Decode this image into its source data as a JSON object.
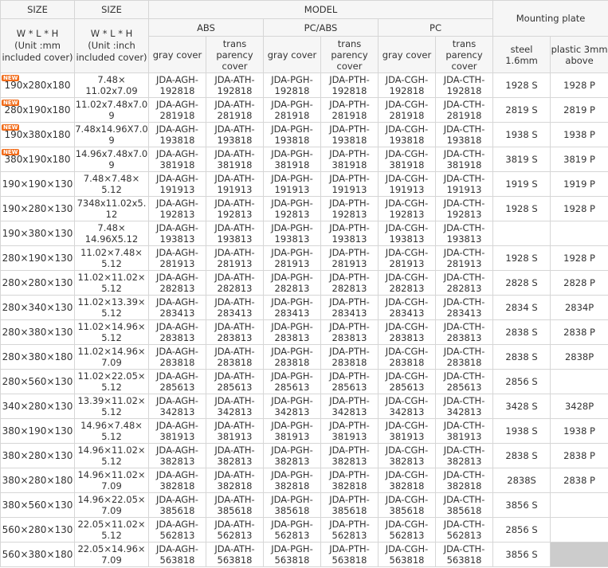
{
  "header": {
    "size_label_1": "SIZE",
    "size_label_2": "SIZE",
    "model": "MODEL",
    "abs": "ABS",
    "pcabs": "PC/ABS",
    "pc": "PC",
    "mounting": "Mounting plate",
    "unit_mm": "W * L * H\n(Unit :mm\nincluded cover)",
    "unit_inch": "W * L * H\n(Unit :inch\nincluded cover)",
    "gray_cover": "gray cover",
    "trans_cover": "trans\nparency\ncover",
    "steel": "steel\n1.6mm",
    "plastic": "plastic 3mm\nabove"
  },
  "new_badge": "NEW",
  "rows": [
    {
      "mm": "190x280x180",
      "inch": "7.48×\n11.02x7.09",
      "c1": "JDA-AGH-\n192818",
      "c2": "JDA-ATH-\n192818",
      "c3": "JDA-PGH-\n192818",
      "c4": "JDA-PTH-\n192818",
      "c5": "JDA-CGH-\n192818",
      "c6": "JDA-CTH-\n192818",
      "steel": "1928 S",
      "plastic": "1928 P",
      "new": true
    },
    {
      "mm": "280x190x180",
      "inch": "11.02x7.48x7.0\n9",
      "c1": "JDA-AGH-\n281918",
      "c2": "JDA-ATH-\n281918",
      "c3": "JDA-PGH-\n281918",
      "c4": "JDA-PTH-\n281918",
      "c5": "JDA-CGH-\n281918",
      "c6": "JDA-CTH-\n281918",
      "steel": "2819 S",
      "plastic": "2819 P",
      "new": true
    },
    {
      "mm": "190x380x180",
      "inch": "7.48x14.96X7.0\n9",
      "c1": "JDA-AGH-\n193818",
      "c2": "JDA-ATH-\n193818",
      "c3": "JDA-PGH-\n193818",
      "c4": "JDA-PTH-\n193818",
      "c5": "JDA-CGH-\n193818",
      "c6": "JDA-CTH-\n193818",
      "steel": "1938 S",
      "plastic": "1938 P",
      "new": true
    },
    {
      "mm": "380x190x180",
      "inch": "14.96x7.48x7.0\n9",
      "c1": "JDA-AGH-\n381918",
      "c2": "JDA-ATH-\n381918",
      "c3": "JDA-PGH-\n381918",
      "c4": "JDA-PTH-\n381918",
      "c5": "JDA-CGH-\n381918",
      "c6": "JDA-CTH-\n381918",
      "steel": "3819 S",
      "plastic": "3819 P",
      "new": true
    },
    {
      "mm": "190×190×130",
      "inch": "7.48×7.48×\n5.12",
      "c1": "JDA-AGH-\n191913",
      "c2": "JDA-ATH-\n191913",
      "c3": "JDA-PGH-\n191913",
      "c4": "JDA-PTH-\n191913",
      "c5": "JDA-CGH-\n191913",
      "c6": "JDA-CTH-\n191913",
      "steel": "1919 S",
      "plastic": "1919 P"
    },
    {
      "mm": "190×280×130",
      "inch": "7348x11.02x5.\n12",
      "c1": "JDA-AGH-\n192813",
      "c2": "JDA-ATH-\n192813",
      "c3": "JDA-PGH-\n192813",
      "c4": "JDA-PTH-\n192813",
      "c5": "JDA-CGH-\n192813",
      "c6": "JDA-CTH-\n192813",
      "steel": "1928 S",
      "plastic": "1928 P"
    },
    {
      "mm": "190×380×130",
      "inch": "7.48×\n14.96X5.12",
      "c1": "JDA-AGH-\n193813",
      "c2": "JDA-ATH-\n193813",
      "c3": "JDA-PGH-\n193813",
      "c4": "JDA-PTH-\n193813",
      "c5": "JDA-CGH-\n193813",
      "c6": "JDA-CTH-\n193813",
      "steel": "",
      "plastic": ""
    },
    {
      "mm": "280×190×130",
      "inch": "11.02×7.48×\n5.12",
      "c1": "JDA-AGH-\n281913",
      "c2": "JDA-ATH-\n281913",
      "c3": "JDA-PGH-\n281913",
      "c4": "JDA-PTH-\n281913",
      "c5": "JDA-CGH-\n281913",
      "c6": "JDA-CTH-\n281913",
      "steel": "1928 S",
      "plastic": "1928 P"
    },
    {
      "mm": "280×280×130",
      "inch": "11.02×11.02×\n5.12",
      "c1": "JDA-AGH-\n282813",
      "c2": "JDA-ATH-\n282813",
      "c3": "JDA-PGH-\n282813",
      "c4": "JDA-PTH-\n282813",
      "c5": "JDA-CGH-\n282813",
      "c6": "JDA-CTH-\n282813",
      "steel": "2828 S",
      "plastic": "2828 P"
    },
    {
      "mm": "280×340×130",
      "inch": "11.02×13.39×\n5.12",
      "c1": "JDA-AGH-\n283413",
      "c2": "JDA-ATH-\n283413",
      "c3": "JDA-PGH-\n283413",
      "c4": "JDA-PTH-\n283413",
      "c5": "JDA-CGH-\n283413",
      "c6": "JDA-CTH-\n283413",
      "steel": "2834 S",
      "plastic": "2834P"
    },
    {
      "mm": "280×380×130",
      "inch": "11.02×14.96×\n5.12",
      "c1": "JDA-AGH-\n283813",
      "c2": "JDA-ATH-\n283813",
      "c3": "JDA-PGH-\n283813",
      "c4": "JDA-PTH-\n283813",
      "c5": "JDA-CGH-\n283813",
      "c6": "JDA-CTH-\n283813",
      "steel": "2838 S",
      "plastic": "2838 P"
    },
    {
      "mm": "280×380×180",
      "inch": "11.02×14.96×\n7.09",
      "c1": "JDA-AGH-\n283818",
      "c2": "JDA-ATH-\n283818",
      "c3": "JDA-PGH-\n283818",
      "c4": "JDA-PTH-\n283818",
      "c5": "JDA-CGH-\n283818",
      "c6": "JDA-CTH-\n283818",
      "steel": "2838 S",
      "plastic": "2838P"
    },
    {
      "mm": "280×560×130",
      "inch": "11.02×22.05×\n5.12",
      "c1": "JDA-AGH-\n285613",
      "c2": "JDA-ATH-\n285613",
      "c3": "JDA-PGH-\n285613",
      "c4": "JDA-PTH-\n285613",
      "c5": "JDA-CGH-\n285613",
      "c6": "JDA-CTH-\n285613",
      "steel": "2856 S",
      "plastic": ""
    },
    {
      "mm": "340×280×130",
      "inch": "13.39×11.02×\n5.12",
      "c1": "JDA-AGH-\n342813",
      "c2": "JDA-ATH-\n342813",
      "c3": "JDA-PGH-\n342813",
      "c4": "JDA-PTH-\n342813",
      "c5": "JDA-CGH-\n342813",
      "c6": "JDA-CTH-\n342813",
      "steel": "3428 S",
      "plastic": "3428P"
    },
    {
      "mm": "380×190×130",
      "inch": "14.96×7.48×\n5.12",
      "c1": "JDA-AGH-\n381913",
      "c2": "JDA-ATH-\n381913",
      "c3": "JDA-PGH-\n381913",
      "c4": "JDA-PTH-\n381913",
      "c5": "JDA-CGH-\n381913",
      "c6": "JDA-CTH-\n381913",
      "steel": "1938 S",
      "plastic": "1938 P"
    },
    {
      "mm": "380×280×130",
      "inch": "14.96×11.02×\n5.12",
      "c1": "JDA-AGH-\n382813",
      "c2": "JDA-ATH-\n382813",
      "c3": "JDA-PGH-\n382813",
      "c4": "JDA-PTH-\n382813",
      "c5": "JDA-CGH-\n382813",
      "c6": "JDA-CTH-\n382813",
      "steel": "2838 S",
      "plastic": "2838 P"
    },
    {
      "mm": "380×280×180",
      "inch": "14.96×11.02×\n7.09",
      "c1": "JDA-AGH-\n382818",
      "c2": "JDA-ATH-\n382818",
      "c3": "JDA-PGH-\n382818",
      "c4": "JDA-PTH-\n382818",
      "c5": "JDA-CGH-\n382818",
      "c6": "JDA-CTH-\n382818",
      "steel": "2838S",
      "plastic": "2838 P"
    },
    {
      "mm": "380×560×130",
      "inch": "14.96×22.05×\n7.09",
      "c1": "JDA-AGH-\n385618",
      "c2": "JDA-ATH-\n385618",
      "c3": "JDA-PGH-\n385618",
      "c4": "JDA-PTH-\n385618",
      "c5": "JDA-CGH-\n385618",
      "c6": "JDA-CTH-\n385618",
      "steel": "3856 S",
      "plastic": ""
    },
    {
      "mm": "560×280×130",
      "inch": "22.05×11.02×\n5.12",
      "c1": "JDA-AGH-\n562813",
      "c2": "JDA-ATH-\n562813",
      "c3": "JDA-PGH-\n562813",
      "c4": "JDA-PTH-\n562813",
      "c5": "JDA-CGH-\n562813",
      "c6": "JDA-CTH-\n562813",
      "steel": "2856 S",
      "plastic": ""
    },
    {
      "mm": "560×380×180",
      "inch": "22.05×14.96×\n7.09",
      "c1": "JDA-AGH-\n563818",
      "c2": "JDA-ATH-\n563818",
      "c3": "JDA-PGH-\n563818",
      "c4": "JDA-PTH-\n563818",
      "c5": "JDA-CGH-\n563818",
      "c6": "JDA-CTH-\n563818",
      "steel": "3856 S",
      "plastic": "",
      "plastic_gray": true
    }
  ],
  "colors": {
    "border": "#d6d6d6",
    "header_bg": "#f6f6f6",
    "new_badge": "#f26c1a",
    "gray_cell": "#cccccc"
  }
}
